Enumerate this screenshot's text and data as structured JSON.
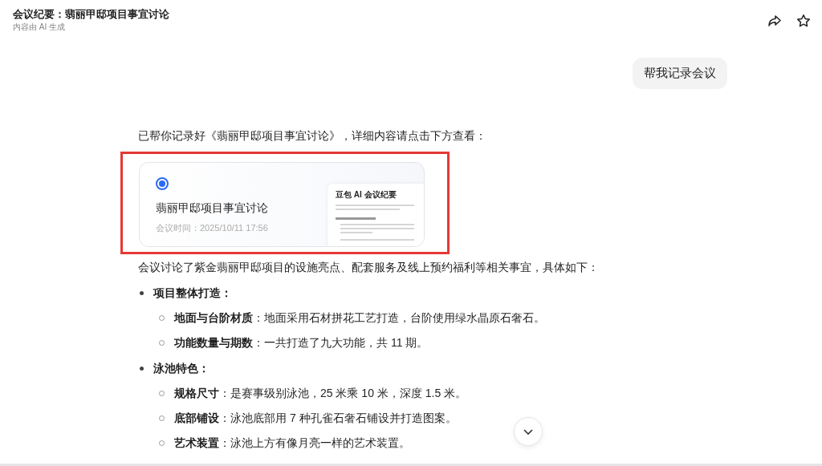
{
  "header": {
    "title": "会议纪要：翡丽甲邸项目事宜讨论",
    "subtitle": "内容由 AI 生成"
  },
  "user_message": "帮我记录会议",
  "reply": {
    "intro": "已帮你记录好《翡丽甲邸项目事宜讨论》，详细内容请点击下方查看：",
    "card": {
      "selected": true,
      "title": "翡丽甲邸项目事宜讨论",
      "meta": "会议时间：2025/10/11 17:56",
      "preview_title": "豆包 AI 会议纪要"
    },
    "summary": "会议讨论了紫金翡丽甲邸项目的设施亮点、配套服务及线上预约福利等相关事宜，具体如下：",
    "sections": [
      {
        "heading": "项目整体打造：",
        "items": [
          {
            "text": "**地面与台阶材质**：地面采用石材拼花工艺打造，台阶使用绿水晶原石奢石。"
          },
          {
            "text": "**功能数量与期数**：一共打造了九大功能，共 11 期。"
          }
        ]
      },
      {
        "heading": "泳池特色：",
        "items": [
          {
            "text": "**规格尺寸**：是赛事级别泳池，25 米乘 10 米，深度 1.5 米。"
          },
          {
            "text": "**底部铺设**：泳池底部用 7 种孔雀石奢石铺设并打造图案。"
          },
          {
            "text": "**艺术装置**：泳池上方有像月亮一样的艺术装置。"
          }
        ]
      }
    ]
  }
}
